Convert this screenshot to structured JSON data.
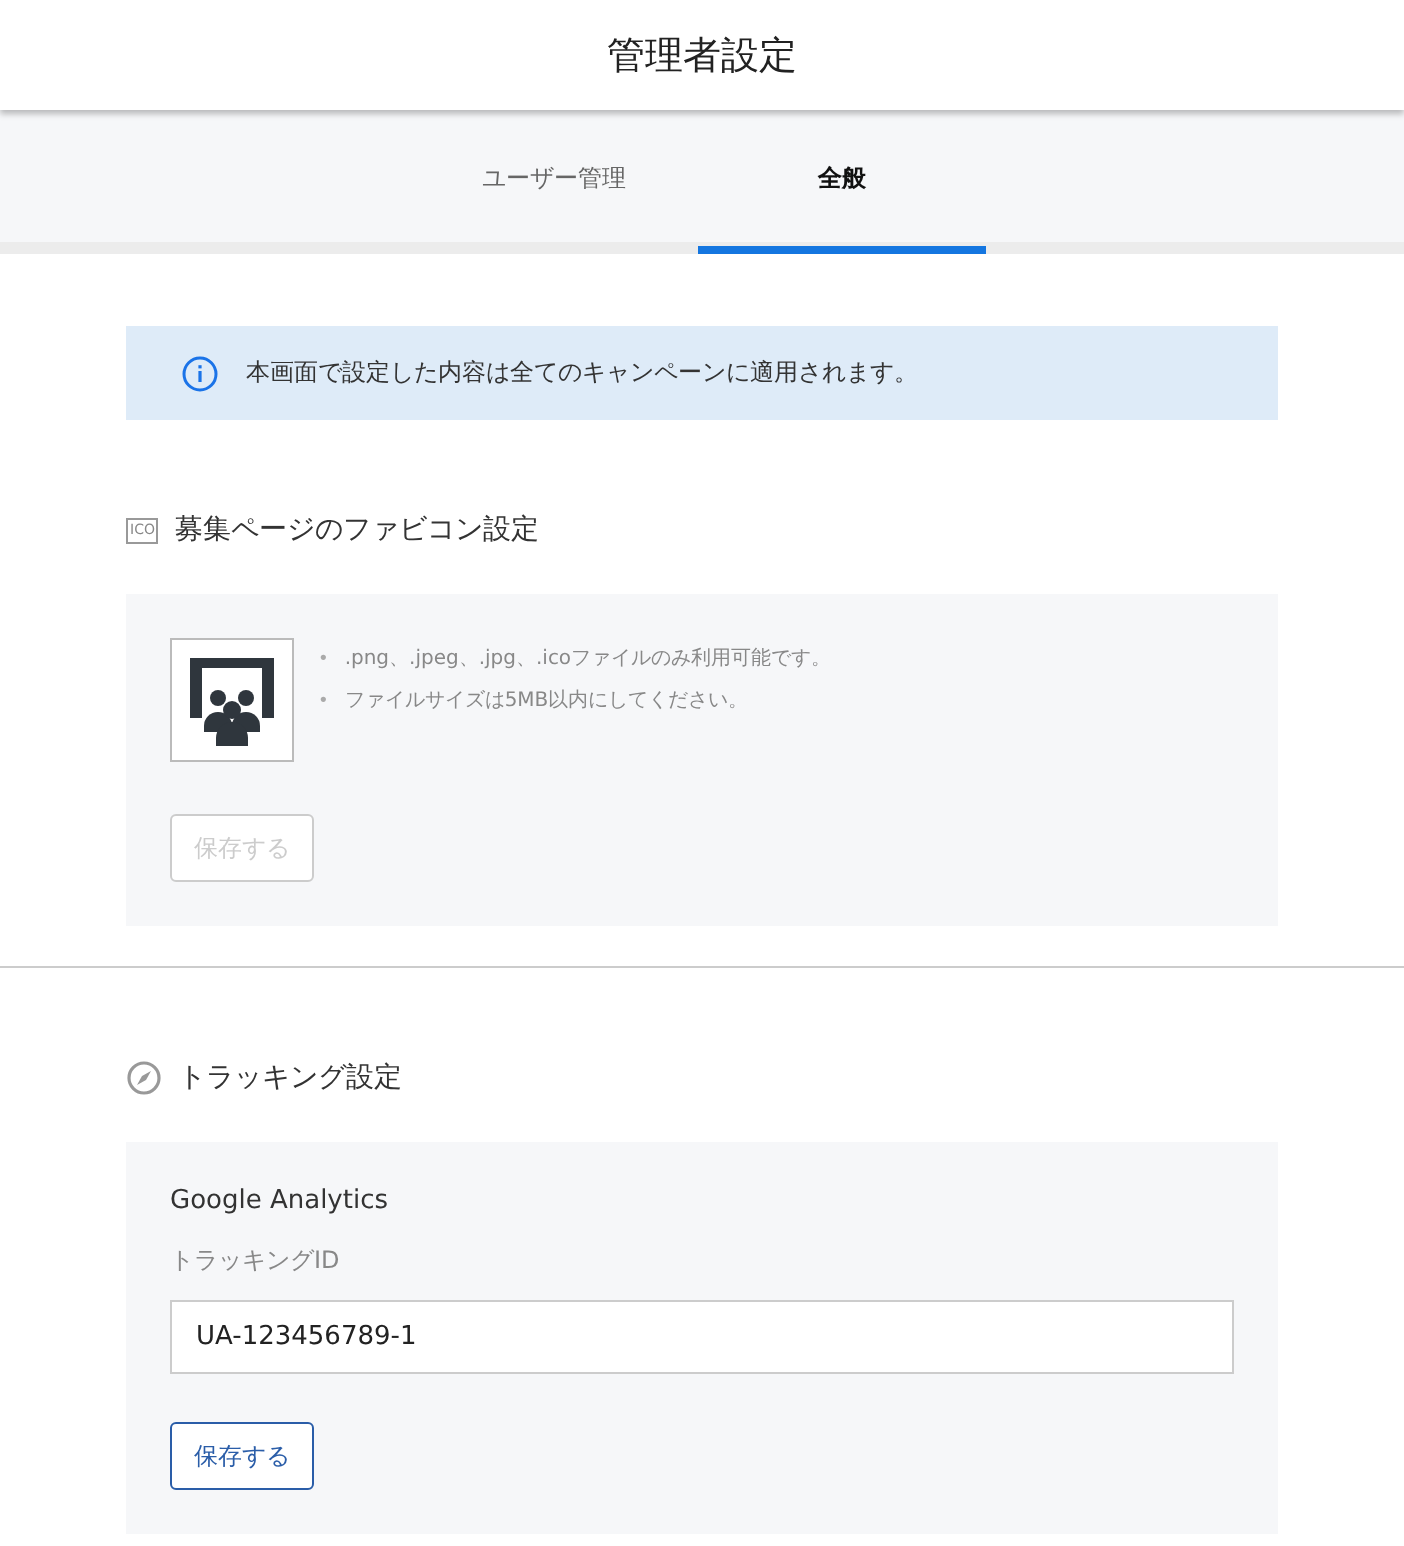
{
  "header": {
    "title": "管理者設定"
  },
  "tabs": [
    {
      "label": "ユーザー管理",
      "selected": false
    },
    {
      "label": "全般",
      "selected": true
    }
  ],
  "notice": {
    "text": "本画面で設定した内容は全てのキャンペーンに適用されます。"
  },
  "favicon_section": {
    "icon_text": "ICO",
    "title": "募集ページのファビコン設定",
    "notes": [
      {
        "bullet": "•",
        "text": ".png、.jpeg、.jpg、.icoファイルのみ利用可能です。"
      },
      {
        "bullet": "•",
        "text": "ファイルサイズは5MB以内にしてください。"
      }
    ],
    "save_button": {
      "label": "保存する",
      "disabled": true
    }
  },
  "tracking_section": {
    "title": "トラッキング設定",
    "service": "Google Analytics",
    "field_label": "トラッキングID",
    "value": "UA-123456789-1",
    "save_button": {
      "label": "保存する",
      "disabled": false
    }
  }
}
